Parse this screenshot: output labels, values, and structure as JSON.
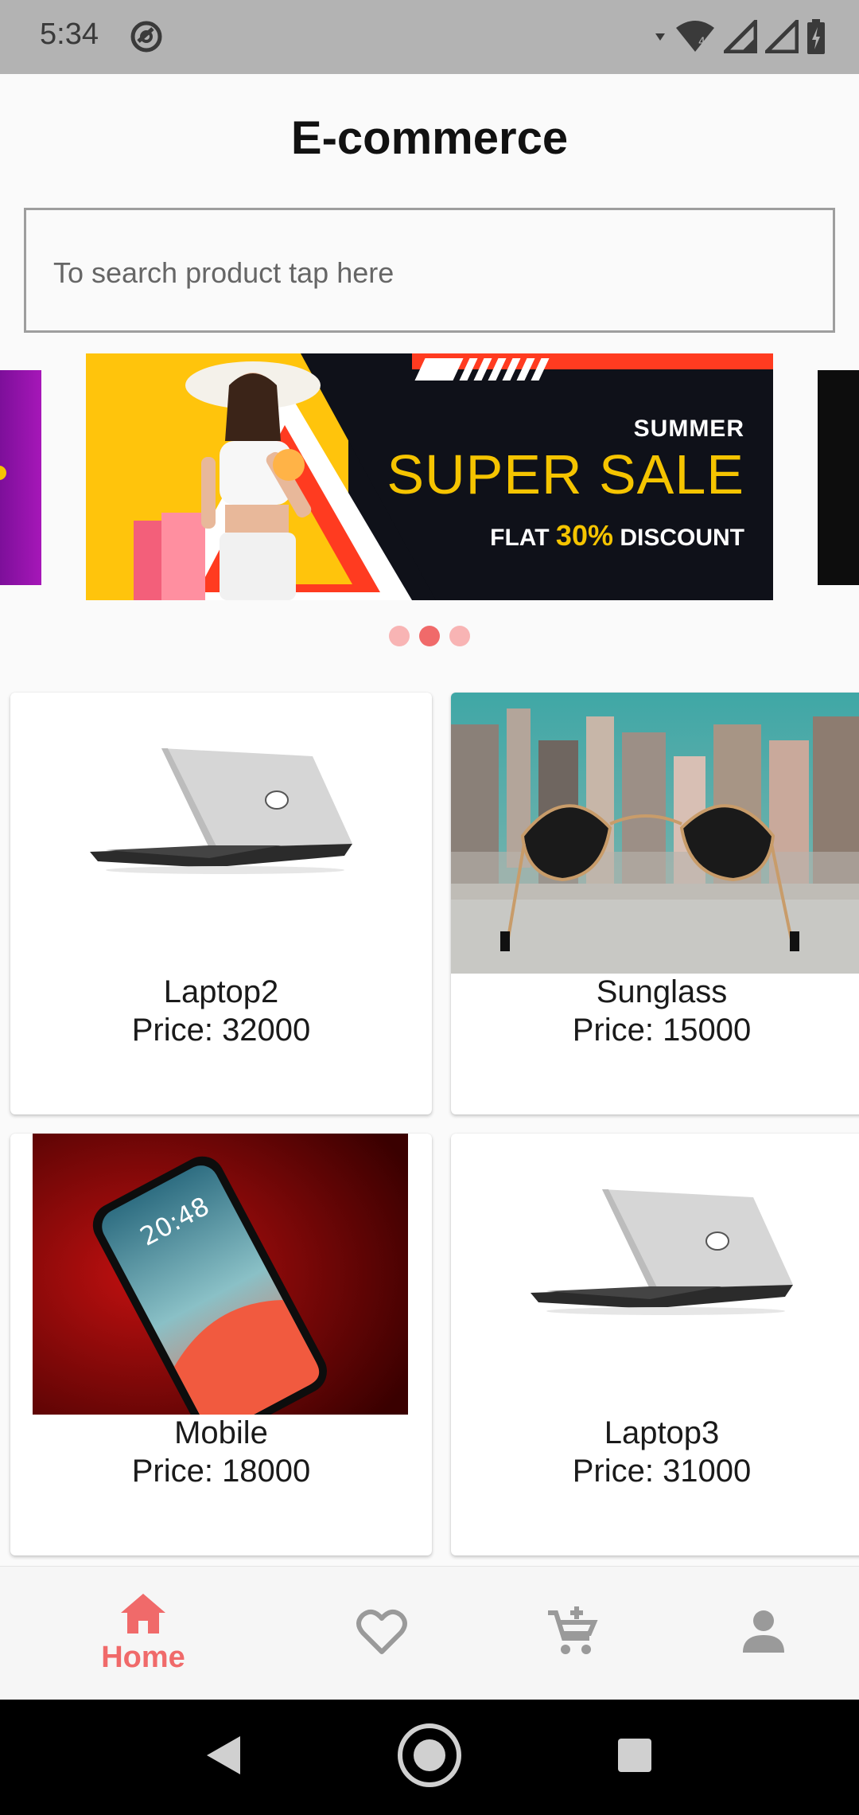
{
  "status_bar": {
    "time": "5:34",
    "icons": [
      "do-not-disturb-icon",
      "wifi-icon",
      "signal-icon",
      "battery-charging-icon"
    ]
  },
  "header": {
    "title": "E-commerce"
  },
  "search": {
    "placeholder": "To search product tap here"
  },
  "carousel": {
    "banner": {
      "line1": "SUMMER",
      "line2": "SUPER SALE",
      "line3_prefix": "FLAT",
      "line3_highlight": "30%",
      "line3_suffix": "DISCOUNT"
    },
    "dots": 3,
    "active_dot": 1
  },
  "products": [
    {
      "name": "Laptop2",
      "price": "Price: 32000",
      "image": "laptop-image"
    },
    {
      "name": "Sunglass",
      "price": "Price: 15000",
      "image": "sunglass-image"
    },
    {
      "name": "Mobile",
      "price": "Price: 18000",
      "image": "mobile-image"
    },
    {
      "name": "Laptop3",
      "price": "Price: 31000",
      "image": "laptop-image"
    }
  ],
  "bottom_nav": {
    "items": [
      {
        "label": "Home",
        "icon": "home-icon",
        "active": true
      },
      {
        "label": "",
        "icon": "heart-icon",
        "active": false
      },
      {
        "label": "",
        "icon": "cart-add-icon",
        "active": false
      },
      {
        "label": "",
        "icon": "person-icon",
        "active": false
      }
    ]
  },
  "colors": {
    "accent": "#f06a6a",
    "status_bar": "#b3b3b3",
    "banner_yellow": "#f5c400"
  }
}
